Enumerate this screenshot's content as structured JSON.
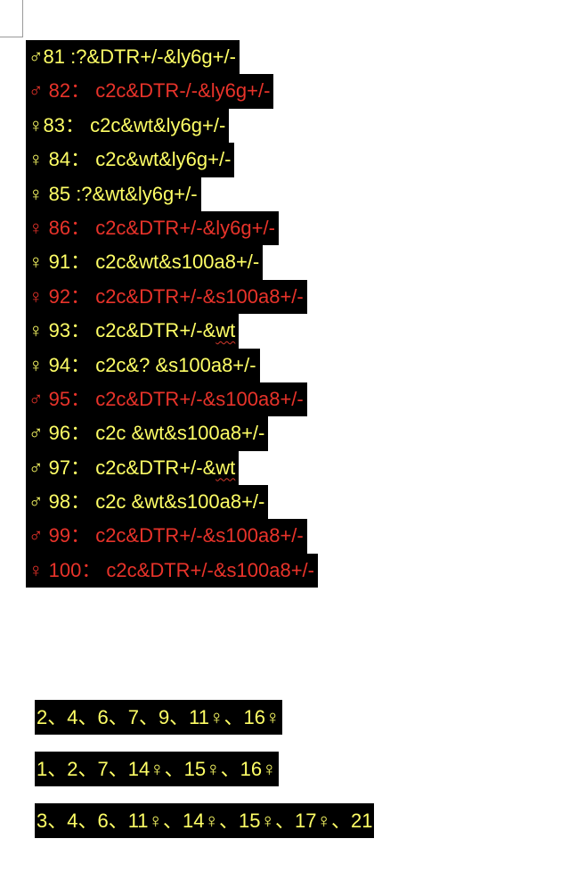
{
  "mouse_lines": [
    {
      "sex": "♂",
      "text": "81 :?&DTR+/-&ly6g+/-",
      "color": "yellow"
    },
    {
      "sex": "♂",
      "text": " 82： c2c&DTR-/-&ly6g+/-",
      "color": "red"
    },
    {
      "sex": "♀",
      "text": "83： c2c&wt&ly6g+/-",
      "color": "yellow"
    },
    {
      "sex": "♀",
      "text": " 84： c2c&wt&ly6g+/-",
      "color": "yellow"
    },
    {
      "sex": "♀",
      "text": " 85 :?&wt&ly6g+/-",
      "color": "yellow"
    },
    {
      "sex": "♀",
      "text": " 86： c2c&DTR+/-&ly6g+/-",
      "color": "red"
    },
    {
      "sex": "♀",
      "text": " 91： c2c&wt&s100a8+/-",
      "color": "yellow"
    },
    {
      "sex": "♀",
      "text": " 92： c2c&DTR+/-&s100a8+/-",
      "color": "red"
    },
    {
      "sex": "♀",
      "text": " 93： c2c&DTR+/-&",
      "suffix": "wt",
      "color": "yellow"
    },
    {
      "sex": "♀",
      "text": " 94： c2c&? &s100a8+/-",
      "color": "yellow"
    },
    {
      "sex": "♂",
      "text": " 95： c2c&DTR+/-&s100a8+/-",
      "color": "red"
    },
    {
      "sex": "♂",
      "text": " 96： c2c &wt&s100a8+/-",
      "color": "yellow"
    },
    {
      "sex": "♂",
      "text": " 97： c2c&DTR+/-&",
      "suffix": "wt",
      "color": "yellow"
    },
    {
      "sex": "♂",
      "text": " 98： c2c &wt&s100a8+/-",
      "color": "yellow"
    },
    {
      "sex": "♂",
      "text": " 99： c2c&DTR+/-&s100a8+/-",
      "color": "red"
    },
    {
      "sex": "♀",
      "text": " 100： c2c&DTR+/-&s100a8+/-",
      "color": "red"
    }
  ],
  "group_lines": [
    "2、4、6、7、9、11♀、16♀",
    "1、2、7、14♀、15♀、16♀",
    "3、4、6、11♀、14♀、15♀、17♀、21"
  ],
  "colors": {
    "highlight": "#000000",
    "yellow_text": "#ffff66",
    "red_text": "#e8332a",
    "spellcheck_squiggle": "#d33a2c"
  }
}
